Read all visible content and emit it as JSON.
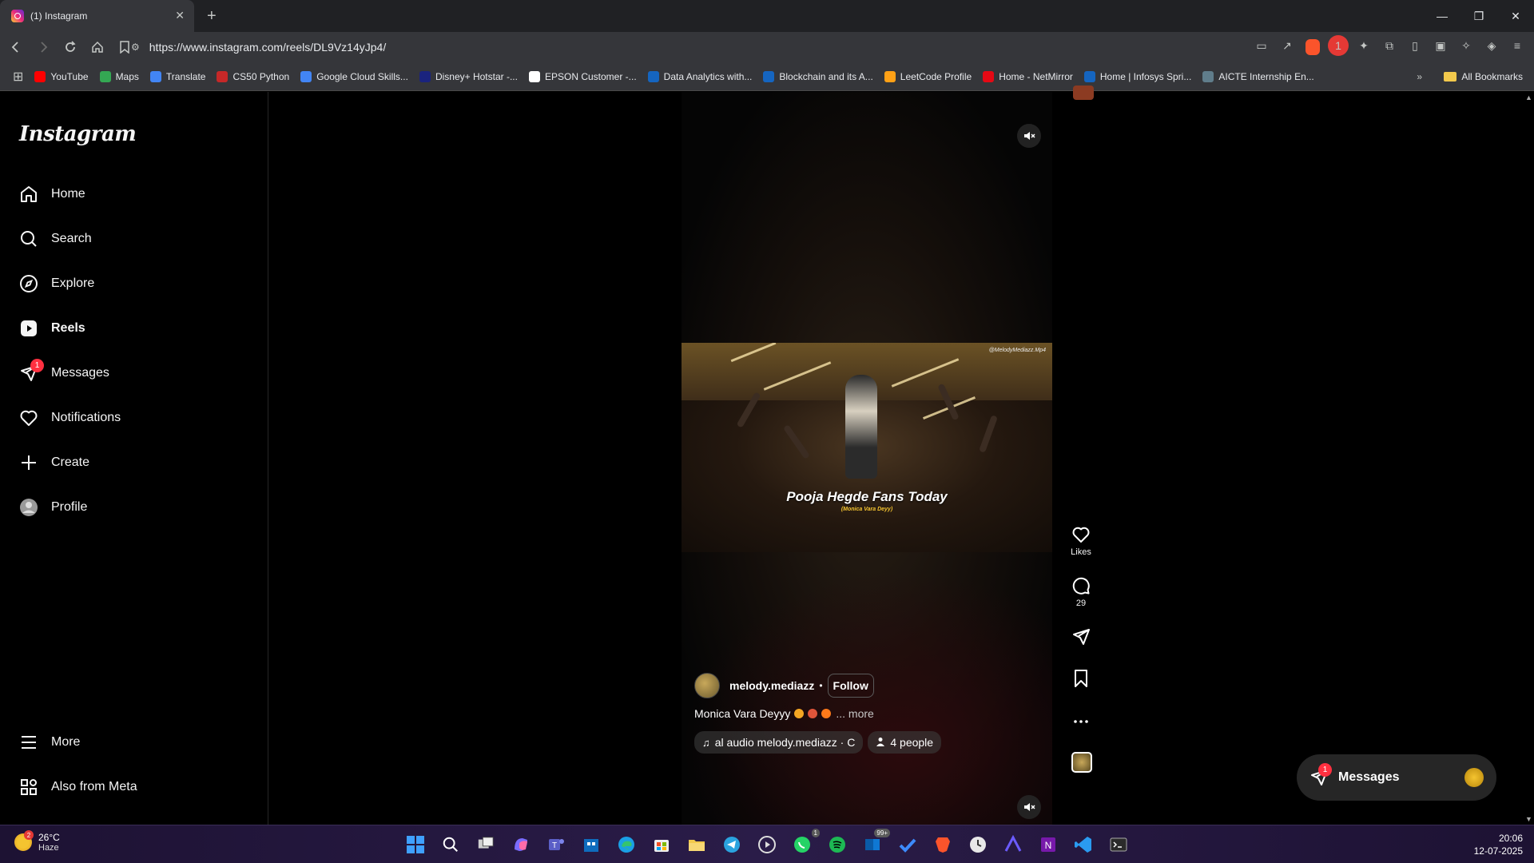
{
  "browser": {
    "tab_title": "(1) Instagram",
    "tab_close": "✕",
    "new_tab": "+",
    "url": "https://www.instagram.com/reels/DL9Vz14yJp4/",
    "window_controls": [
      "—",
      "❐",
      "✕"
    ]
  },
  "bookmarks": {
    "items": [
      {
        "label": "YouTube",
        "color": "#ff0000"
      },
      {
        "label": "Maps",
        "color": "#34a853"
      },
      {
        "label": "Translate",
        "color": "#4285f4"
      },
      {
        "label": "CS50 Python",
        "color": "#c62828"
      },
      {
        "label": "Google Cloud Skills...",
        "color": "#4285f4"
      },
      {
        "label": "Disney+ Hotstar -...",
        "color": "#1a237e"
      },
      {
        "label": "EPSON Customer -...",
        "color": "#ffffff"
      },
      {
        "label": "Data Analytics with...",
        "color": "#1565c0"
      },
      {
        "label": "Blockchain and its A...",
        "color": "#1565c0"
      },
      {
        "label": "LeetCode Profile",
        "color": "#ffa116"
      },
      {
        "label": "Home - NetMirror",
        "color": "#e50914"
      },
      {
        "label": "Home | Infosys Spri...",
        "color": "#1565c0"
      },
      {
        "label": "AICTE Internship En...",
        "color": "#607d8b"
      }
    ],
    "more": "»",
    "all_bookmarks": "All Bookmarks"
  },
  "sidebar": {
    "logo": "Instagram",
    "items": [
      {
        "label": "Home",
        "icon": "home-icon"
      },
      {
        "label": "Search",
        "icon": "search-icon"
      },
      {
        "label": "Explore",
        "icon": "compass-icon"
      },
      {
        "label": "Reels",
        "icon": "reels-icon"
      },
      {
        "label": "Messages",
        "icon": "messenger-icon",
        "badge": "1"
      },
      {
        "label": "Notifications",
        "icon": "heart-icon"
      },
      {
        "label": "Create",
        "icon": "plus-icon"
      },
      {
        "label": "Profile",
        "icon": "avatar-icon"
      },
      {
        "label": "More",
        "icon": "menu-icon"
      },
      {
        "label": "Also from Meta",
        "icon": "meta-grid-icon"
      }
    ]
  },
  "reel": {
    "video_title": "Pooja Hegde Fans Today",
    "video_subtitle": "(Monica Vara Deyy)",
    "watermark": "@MelodyMediazz.Mp4",
    "username": "melody.mediazz",
    "separator": "•",
    "follow": "Follow",
    "caption": "Monica Vara Deyyy",
    "more": "... more",
    "audio": "al audio  melody.mediazz · C",
    "people": "4 people",
    "likes_label": "Likes",
    "comments_count": "29"
  },
  "floating_messages": {
    "label": "Messages",
    "badge": "1"
  },
  "taskbar": {
    "temperature": "26°C",
    "condition": "Haze",
    "weather_badge": "2",
    "time": "20:06",
    "date": "12-07-2025",
    "whatsapp_badge": "1",
    "mail_badge": "99+"
  }
}
